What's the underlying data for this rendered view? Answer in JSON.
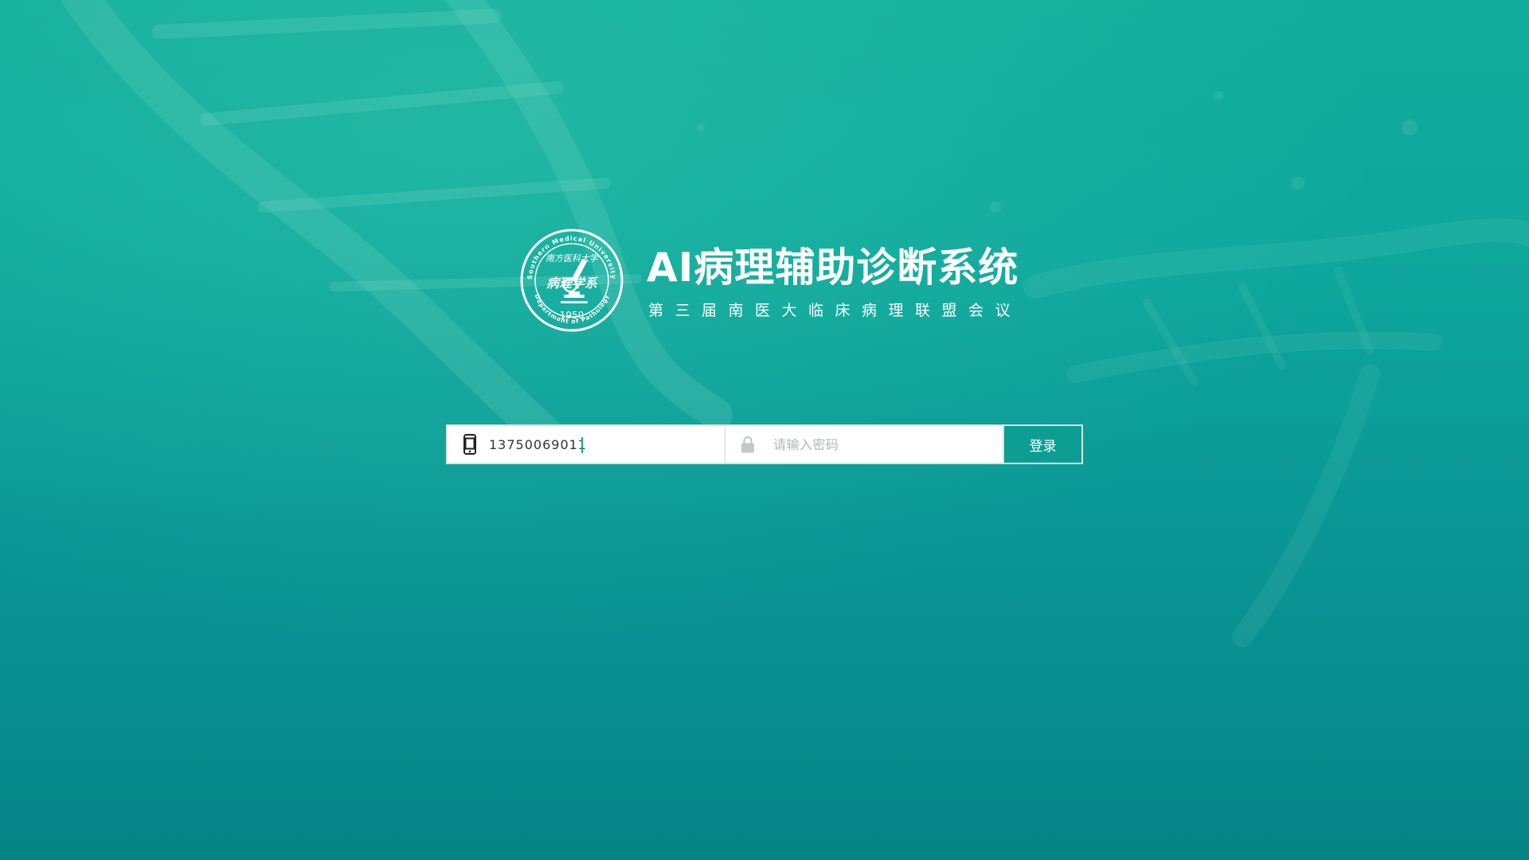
{
  "brand": {
    "title": "AI病理辅助诊断系统",
    "subtitle": "第三届南医大临床病理联盟会议",
    "seal": {
      "top_text": "Southern Medical University",
      "calligraphy": "病理学系",
      "year": "1950",
      "bottom_text": "Department of Pathology",
      "upper_calligraphy": "南方医科大学"
    }
  },
  "login": {
    "phone": {
      "value": "13750069011",
      "placeholder": "",
      "icon": "mobile-phone-icon"
    },
    "password": {
      "value": "",
      "placeholder": "请输入密码",
      "icon": "lock-icon"
    },
    "submit_label": "登录"
  },
  "colors": {
    "background_top": "#12ad9b",
    "background_bottom": "#068486",
    "button": "#0c9e92",
    "field_border": "#d8e6e4",
    "text": "#333333",
    "placeholder": "#b2b6b6"
  }
}
